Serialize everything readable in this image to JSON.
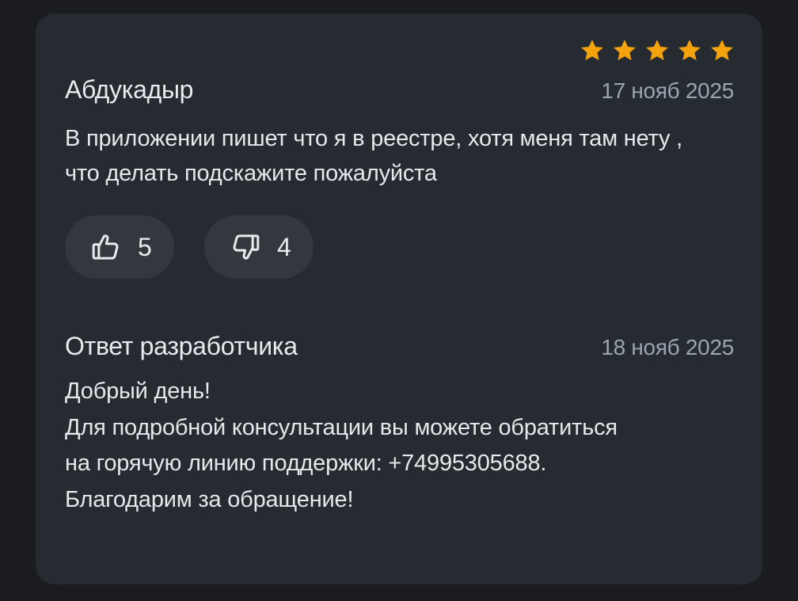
{
  "review": {
    "rating": 5,
    "rating_max": 5,
    "star_color": "#f5a30c",
    "author": "Абдукадыр",
    "date": "17 нояб 2025",
    "text": "В приложении пишет что я в реестре, хотя меня там нету , что делать подскажите пожалуйста",
    "likes": "5",
    "dislikes": "4",
    "like_icon": "thumbs-up-icon",
    "dislike_icon": "thumbs-down-icon"
  },
  "reply": {
    "title": "Ответ разработчика",
    "date": "18 нояб 2025",
    "lines": [
      "Добрый день!",
      "Для подробной консультации вы можете обратиться",
      "на горячую линию поддержки: +74995305688.",
      "Благодарим за обращение!"
    ]
  }
}
